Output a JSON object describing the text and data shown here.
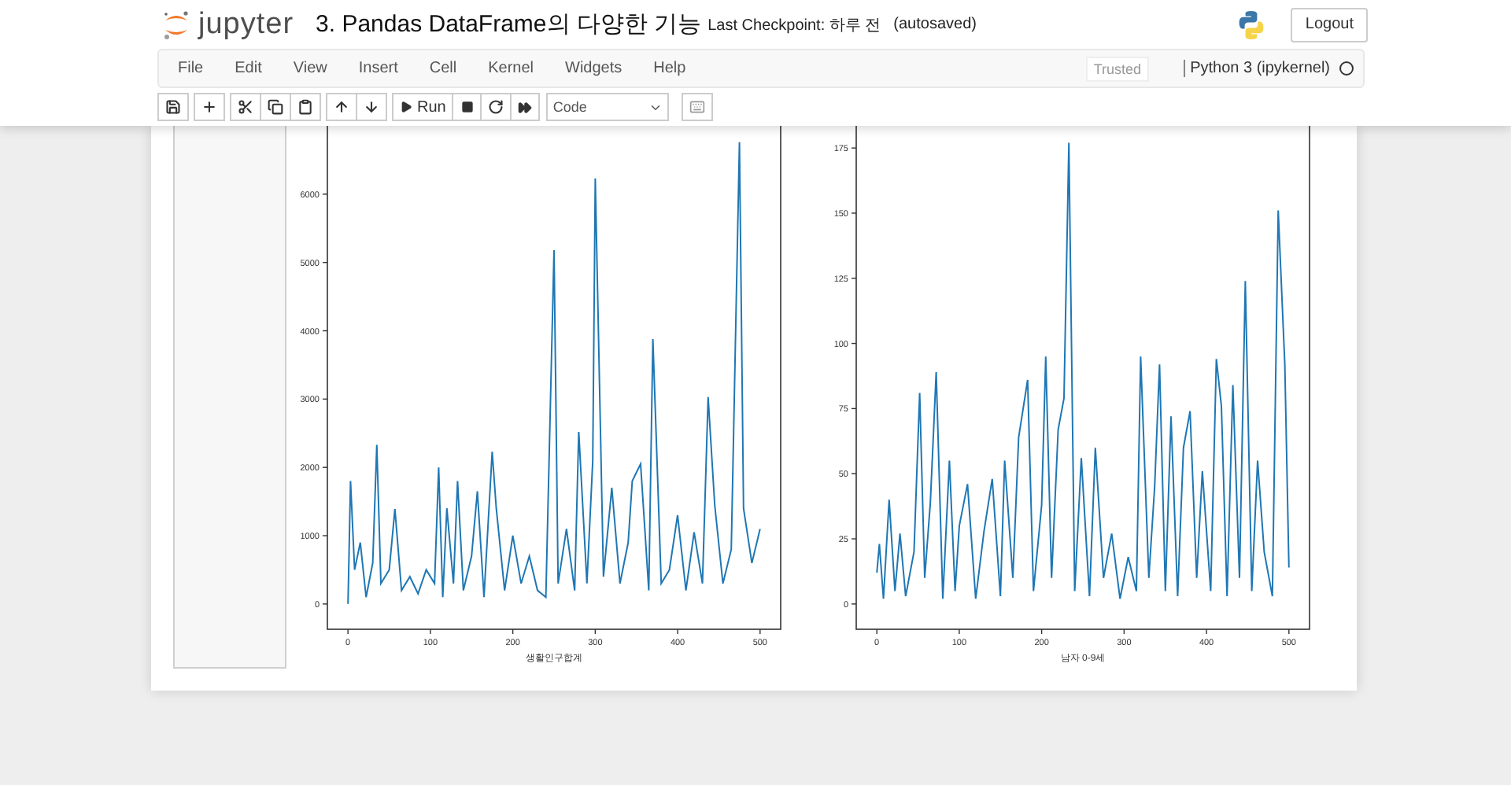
{
  "header": {
    "logo_text": "jupyter",
    "title": "3. Pandas DataFrame의 다양한 기능",
    "checkpoint": "Last Checkpoint: 하루 전",
    "autosave": "(autosaved)",
    "logout": "Logout"
  },
  "menu": [
    "File",
    "Edit",
    "View",
    "Insert",
    "Cell",
    "Kernel",
    "Widgets",
    "Help"
  ],
  "trusted": "Trusted",
  "kernel": {
    "name": "Python 3 (ipykernel)",
    "busy": false
  },
  "toolbar": {
    "run": "Run",
    "cell_type": "Code"
  },
  "charts": [
    {
      "chart_data": {
        "type": "line",
        "xlabel": "생활인구합계",
        "xlim": [
          -25,
          525
        ],
        "ylim": [
          -370,
          7000
        ],
        "xticks": [
          0,
          100,
          200,
          300,
          400,
          500
        ],
        "yticks": [
          0,
          1000,
          2000,
          3000,
          4000,
          5000,
          6000
        ],
        "x": [
          0,
          3,
          8,
          15,
          22,
          30,
          35,
          40,
          50,
          57,
          65,
          75,
          85,
          95,
          105,
          110,
          115,
          120,
          128,
          133,
          140,
          150,
          157,
          165,
          175,
          180,
          190,
          200,
          210,
          220,
          230,
          240,
          250,
          255,
          265,
          275,
          280,
          290,
          297,
          300,
          310,
          320,
          330,
          340,
          345,
          355,
          365,
          370,
          380,
          390,
          400,
          410,
          420,
          430,
          437,
          445,
          455,
          465,
          475,
          480,
          490,
          500
        ],
        "series": [
          {
            "color": "#1f77b4",
            "values": [
              0,
              1800,
              500,
              900,
              100,
              600,
              2330,
              300,
              500,
              1390,
              200,
              400,
              150,
              500,
              300,
              2000,
              100,
              1400,
              300,
              1800,
              200,
              700,
              1650,
              100,
              2230,
              1400,
              200,
              1000,
              300,
              700,
              200,
              100,
              5180,
              300,
              1100,
              200,
              2520,
              300,
              2100,
              6230,
              400,
              1700,
              300,
              900,
              1800,
              2050,
              200,
              3880,
              300,
              500,
              1300,
              200,
              1050,
              300,
              3030,
              1450,
              300,
              800,
              6760,
              1400,
              600,
              1100
            ]
          }
        ]
      }
    },
    {
      "chart_data": {
        "type": "line",
        "xlabel": "남자 0-9세",
        "xlim": [
          -25,
          525
        ],
        "ylim": [
          -9.7,
          183.5
        ],
        "xticks": [
          0,
          100,
          200,
          300,
          400,
          500
        ],
        "yticks": [
          0,
          25,
          50,
          75,
          100,
          125,
          150,
          175
        ],
        "x": [
          0,
          3,
          8,
          15,
          22,
          28,
          35,
          45,
          52,
          58,
          65,
          72,
          80,
          88,
          95,
          100,
          110,
          120,
          130,
          140,
          150,
          155,
          165,
          172,
          183,
          190,
          200,
          205,
          212,
          220,
          227,
          233,
          240,
          248,
          258,
          265,
          275,
          285,
          295,
          305,
          315,
          320,
          330,
          337,
          343,
          350,
          357,
          365,
          372,
          380,
          388,
          395,
          405,
          412,
          418,
          425,
          432,
          440,
          447,
          455,
          462,
          470,
          480,
          487,
          495,
          500
        ],
        "series": [
          {
            "color": "#1f77b4",
            "values": [
              12,
              23,
              2,
              40,
              5,
              27,
              3,
              20,
              81,
              10,
              39,
              89,
              2,
              55,
              5,
              30,
              46,
              2,
              28,
              48,
              3,
              55,
              10,
              64,
              86,
              5,
              38,
              95,
              10,
              67,
              79,
              177,
              5,
              56,
              3,
              60,
              10,
              27,
              2,
              18,
              5,
              95,
              10,
              45,
              92,
              5,
              72,
              3,
              60,
              74,
              10,
              51,
              5,
              94,
              76,
              3,
              84,
              10,
              124,
              5,
              55,
              20,
              3,
              151,
              92,
              14
            ]
          }
        ]
      }
    }
  ]
}
